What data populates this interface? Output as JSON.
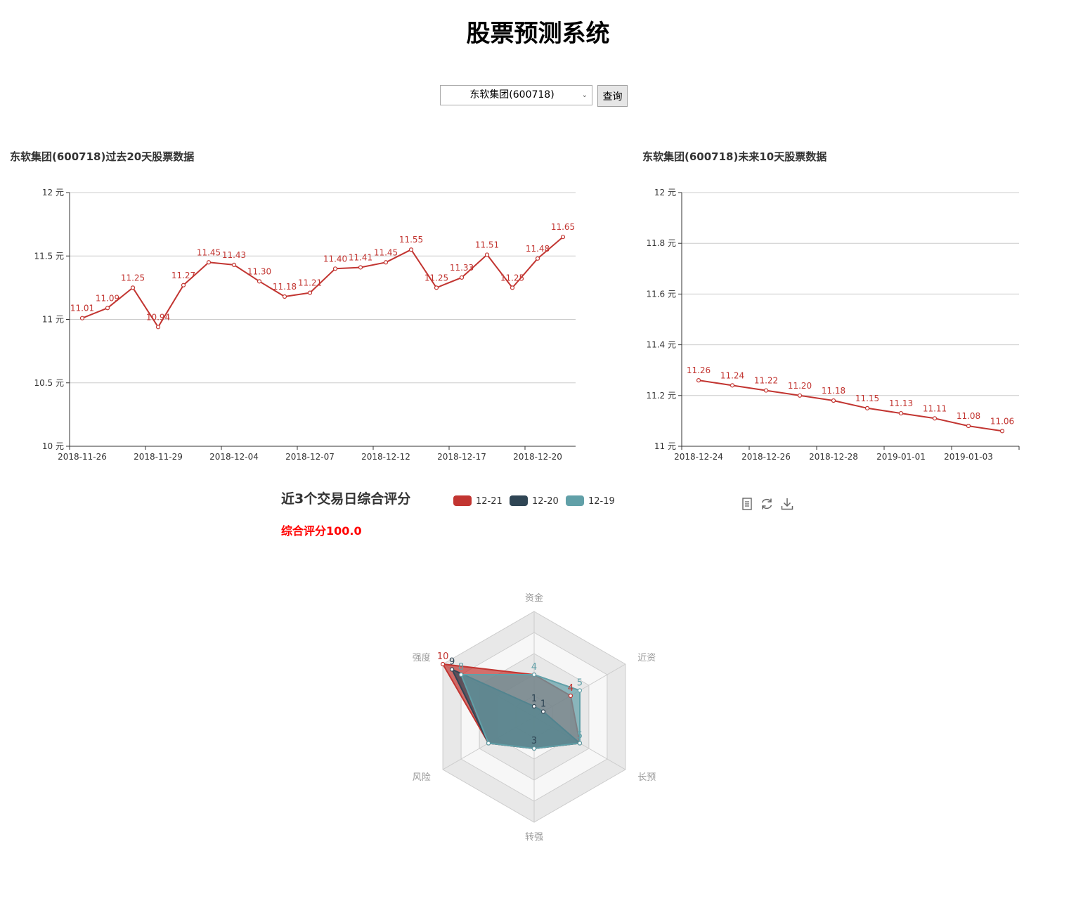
{
  "page": {
    "title": "股票预测系统"
  },
  "query": {
    "selected": "东软集团(600718)",
    "button_label": "查询"
  },
  "charts": {
    "past": {
      "title": "东软集团(600718)过去20天股票数据",
      "tick_labels": [
        "2018-11-26",
        "2018-11-29",
        "2018-12-04",
        "2018-12-07",
        "2018-12-12",
        "2018-12-17",
        "2018-12-20"
      ],
      "y_ticks": [
        "10 元",
        "10.5 元",
        "11 元",
        "11.5 元",
        "12 元"
      ]
    },
    "future": {
      "title": "东软集团(600718)未来10天股票数据",
      "tick_labels": [
        "2018-12-24",
        "2018-12-26",
        "2018-12-28",
        "2019-01-01",
        "2019-01-03"
      ],
      "y_ticks": [
        "11 元",
        "11.2 元",
        "11.4 元",
        "11.6 元",
        "11.8 元",
        "12 元"
      ]
    },
    "radar": {
      "title": "近3个交易日综合评分",
      "subtitle": "综合评分100.0"
    }
  },
  "colors": {
    "past": "#c23531",
    "series": [
      "#c23531",
      "#2f4554",
      "#61a0a8"
    ],
    "score": "#ff0000"
  },
  "toolbar": [
    "data-view-icon",
    "refresh-icon",
    "download-icon"
  ],
  "chart_data": [
    {
      "type": "line",
      "title": "东软集团(600718)过去20天股票数据",
      "unit": "元",
      "ylim": [
        10,
        12
      ],
      "yticks": [
        10,
        10.5,
        11,
        11.5,
        12
      ],
      "grid": true,
      "values": [
        11.01,
        11.09,
        11.25,
        10.94,
        11.27,
        11.45,
        11.43,
        11.3,
        11.18,
        11.21,
        11.4,
        11.41,
        11.45,
        11.55,
        11.25,
        11.33,
        11.51,
        11.25,
        11.48,
        11.65
      ],
      "labels": [
        "11.01",
        "11.09",
        "11.25",
        "10.94",
        "11.27",
        "11.45",
        "11.43",
        "11.30",
        "11.18",
        "11.21",
        "11.40",
        "11.41",
        "11.45",
        "11.55",
        "11.25",
        "11.33",
        "11.51",
        "11.25",
        "11.48",
        "11.65"
      ],
      "tick_labels": [
        "2018-11-26",
        "2018-11-29",
        "2018-12-04",
        "2018-12-07",
        "2018-12-12",
        "2018-12-17",
        "2018-12-20"
      ],
      "tick_every": 3
    },
    {
      "type": "line",
      "title": "东软集团(600718)未来10天股票数据",
      "unit": "元",
      "ylim": [
        11,
        12
      ],
      "yticks": [
        11,
        11.2,
        11.4,
        11.6,
        11.8,
        12
      ],
      "grid": true,
      "values": [
        11.26,
        11.24,
        11.22,
        11.2,
        11.18,
        11.15,
        11.13,
        11.11,
        11.08,
        11.06
      ],
      "labels": [
        "11.26",
        "11.24",
        "11.22",
        "11.20",
        "11.18",
        "11.15",
        "11.13",
        "11.11",
        "11.08",
        "11.06"
      ],
      "tick_labels": [
        "2018-12-24",
        "2018-12-26",
        "2018-12-28",
        "2019-01-01",
        "2019-01-03"
      ],
      "tick_every": 2
    },
    {
      "type": "radar",
      "title": "近3个交易日综合评分",
      "subtitle": "综合评分100.0",
      "indicators": [
        "资金",
        "近资",
        "长预",
        "转强",
        "风险",
        "强度"
      ],
      "max": 10,
      "legend_position": "top",
      "series": [
        {
          "name": "12-21",
          "values": [
            4,
            4,
            5,
            3,
            5,
            10
          ],
          "labels": [
            "",
            "4",
            "",
            "",
            "",
            "10"
          ]
        },
        {
          "name": "12-20",
          "values": [
            1,
            1,
            5,
            3,
            5,
            9
          ],
          "labels": [
            "1",
            "1",
            "",
            "3",
            "",
            "9"
          ]
        },
        {
          "name": "12-19",
          "values": [
            4,
            5,
            5,
            3,
            5,
            8
          ],
          "labels": [
            "4",
            "5",
            "5",
            "",
            "",
            "8"
          ]
        }
      ]
    }
  ]
}
